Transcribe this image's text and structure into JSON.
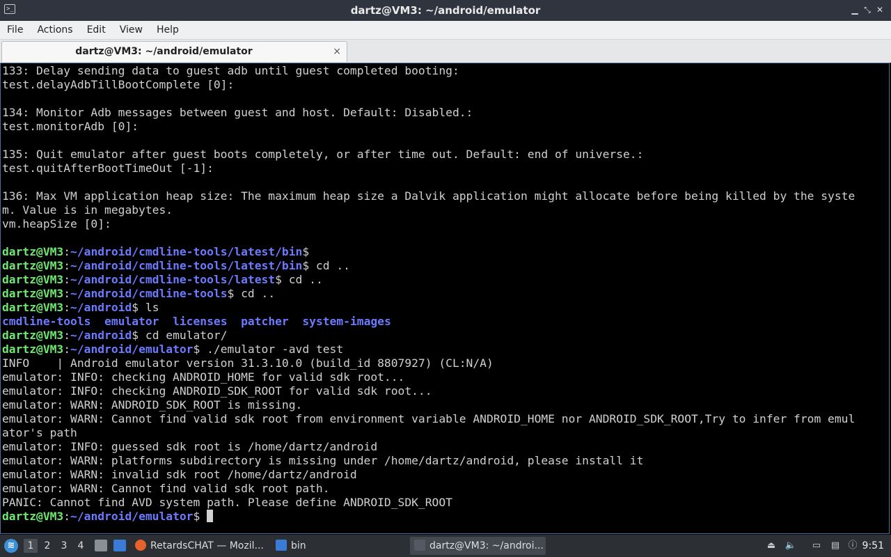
{
  "window": {
    "title": "dartz@VM3: ~/android/emulator",
    "icon": "terminal-icon",
    "controls": {
      "minimize": "▁",
      "restore": "⤡",
      "close": "✕"
    }
  },
  "menu": [
    "File",
    "Actions",
    "Edit",
    "View",
    "Help"
  ],
  "tab": {
    "label": "dartz@VM3: ~/android/emulator",
    "close": "×"
  },
  "colors": {
    "prompt": "#6ee86e",
    "path": "#6b7bff",
    "text": "#d0d0d0",
    "background": "#000000"
  },
  "terminal": {
    "lines": [
      [
        {
          "t": "133: Delay sending data to guest adb until guest completed booting:"
        }
      ],
      [
        {
          "t": "test.delayAdbTillBootComplete [0]:"
        }
      ],
      [],
      [
        {
          "t": "134: Monitor Adb messages between guest and host. Default: Disabled.:"
        }
      ],
      [
        {
          "t": "test.monitorAdb [0]:"
        }
      ],
      [],
      [
        {
          "t": "135: Quit emulator after guest boots completely, or after time out. Default: end of universe.:"
        }
      ],
      [
        {
          "t": "test.quitAfterBootTimeOut [-1]:"
        }
      ],
      [],
      [
        {
          "t": "136: Max VM application heap size: The maximum heap size a Dalvik application might allocate before being killed by the syste"
        }
      ],
      [
        {
          "t": "m. Value is in megabytes."
        }
      ],
      [
        {
          "t": "vm.heapSize [0]:"
        }
      ],
      [],
      [
        {
          "t": "dartz@VM3",
          "c": "prompt"
        },
        {
          "t": ":"
        },
        {
          "t": "~/android/cmdline-tools/latest/bin",
          "c": "path"
        },
        {
          "t": "$"
        }
      ],
      [
        {
          "t": "dartz@VM3",
          "c": "prompt"
        },
        {
          "t": ":"
        },
        {
          "t": "~/android/cmdline-tools/latest/bin",
          "c": "path"
        },
        {
          "t": "$ cd .."
        }
      ],
      [
        {
          "t": "dartz@VM3",
          "c": "prompt"
        },
        {
          "t": ":"
        },
        {
          "t": "~/android/cmdline-tools/latest",
          "c": "path"
        },
        {
          "t": "$ cd .."
        }
      ],
      [
        {
          "t": "dartz@VM3",
          "c": "prompt"
        },
        {
          "t": ":"
        },
        {
          "t": "~/android/cmdline-tools",
          "c": "path"
        },
        {
          "t": "$ cd .."
        }
      ],
      [
        {
          "t": "dartz@VM3",
          "c": "prompt"
        },
        {
          "t": ":"
        },
        {
          "t": "~/android",
          "c": "path"
        },
        {
          "t": "$ ls"
        }
      ],
      [
        {
          "t": "cmdline-tools",
          "c": "dir"
        },
        {
          "t": "  "
        },
        {
          "t": "emulator",
          "c": "dir"
        },
        {
          "t": "  "
        },
        {
          "t": "licenses",
          "c": "dir"
        },
        {
          "t": "  "
        },
        {
          "t": "patcher",
          "c": "dir"
        },
        {
          "t": "  "
        },
        {
          "t": "system-images",
          "c": "dir"
        }
      ],
      [
        {
          "t": "dartz@VM3",
          "c": "prompt"
        },
        {
          "t": ":"
        },
        {
          "t": "~/android",
          "c": "path"
        },
        {
          "t": "$ cd emulator/"
        }
      ],
      [
        {
          "t": "dartz@VM3",
          "c": "prompt"
        },
        {
          "t": ":"
        },
        {
          "t": "~/android/emulator",
          "c": "path"
        },
        {
          "t": "$ ./emulator -avd test"
        }
      ],
      [
        {
          "t": "INFO    | Android emulator version 31.3.10.0 (build_id 8807927) (CL:N/A)"
        }
      ],
      [
        {
          "t": "emulator: INFO: checking ANDROID_HOME for valid sdk root..."
        }
      ],
      [
        {
          "t": "emulator: INFO: checking ANDROID_SDK_ROOT for valid sdk root..."
        }
      ],
      [
        {
          "t": "emulator: WARN: ANDROID_SDK_ROOT is missing."
        }
      ],
      [
        {
          "t": "emulator: WARN: Cannot find valid sdk root from environment variable ANDROID_HOME nor ANDROID_SDK_ROOT,Try to infer from emul"
        }
      ],
      [
        {
          "t": "ator's path"
        }
      ],
      [
        {
          "t": "emulator: INFO: guessed sdk root is /home/dartz/android"
        }
      ],
      [
        {
          "t": "emulator: WARN: platforms subdirectory is missing under /home/dartz/android, please install it"
        }
      ],
      [
        {
          "t": "emulator: WARN: invalid sdk root /home/dartz/android"
        }
      ],
      [
        {
          "t": "emulator: WARN: Cannot find valid sdk root path."
        }
      ],
      [
        {
          "t": "PANIC: Cannot find AVD system path. Please define ANDROID_SDK_ROOT"
        }
      ],
      [
        {
          "t": "dartz@VM3",
          "c": "prompt"
        },
        {
          "t": ":"
        },
        {
          "t": "~/android/emulator",
          "c": "path"
        },
        {
          "t": "$ "
        }
      ]
    ]
  },
  "taskbar": {
    "start_icon": "lubuntu-start-icon",
    "workspaces": [
      "1",
      "2",
      "3",
      "4"
    ],
    "active_workspace": "1",
    "tasks": [
      {
        "label": "RetardsCHAT — Mozil...",
        "icon": "firefox-icon",
        "color": "#e8622c"
      },
      {
        "label": "bin",
        "icon": "folder-icon",
        "color": "#3a7bd5"
      },
      {
        "label": "dartz@VM3: ~/androi...",
        "icon": "terminal-icon",
        "color": "#555a62"
      }
    ],
    "clock": "9:51"
  }
}
